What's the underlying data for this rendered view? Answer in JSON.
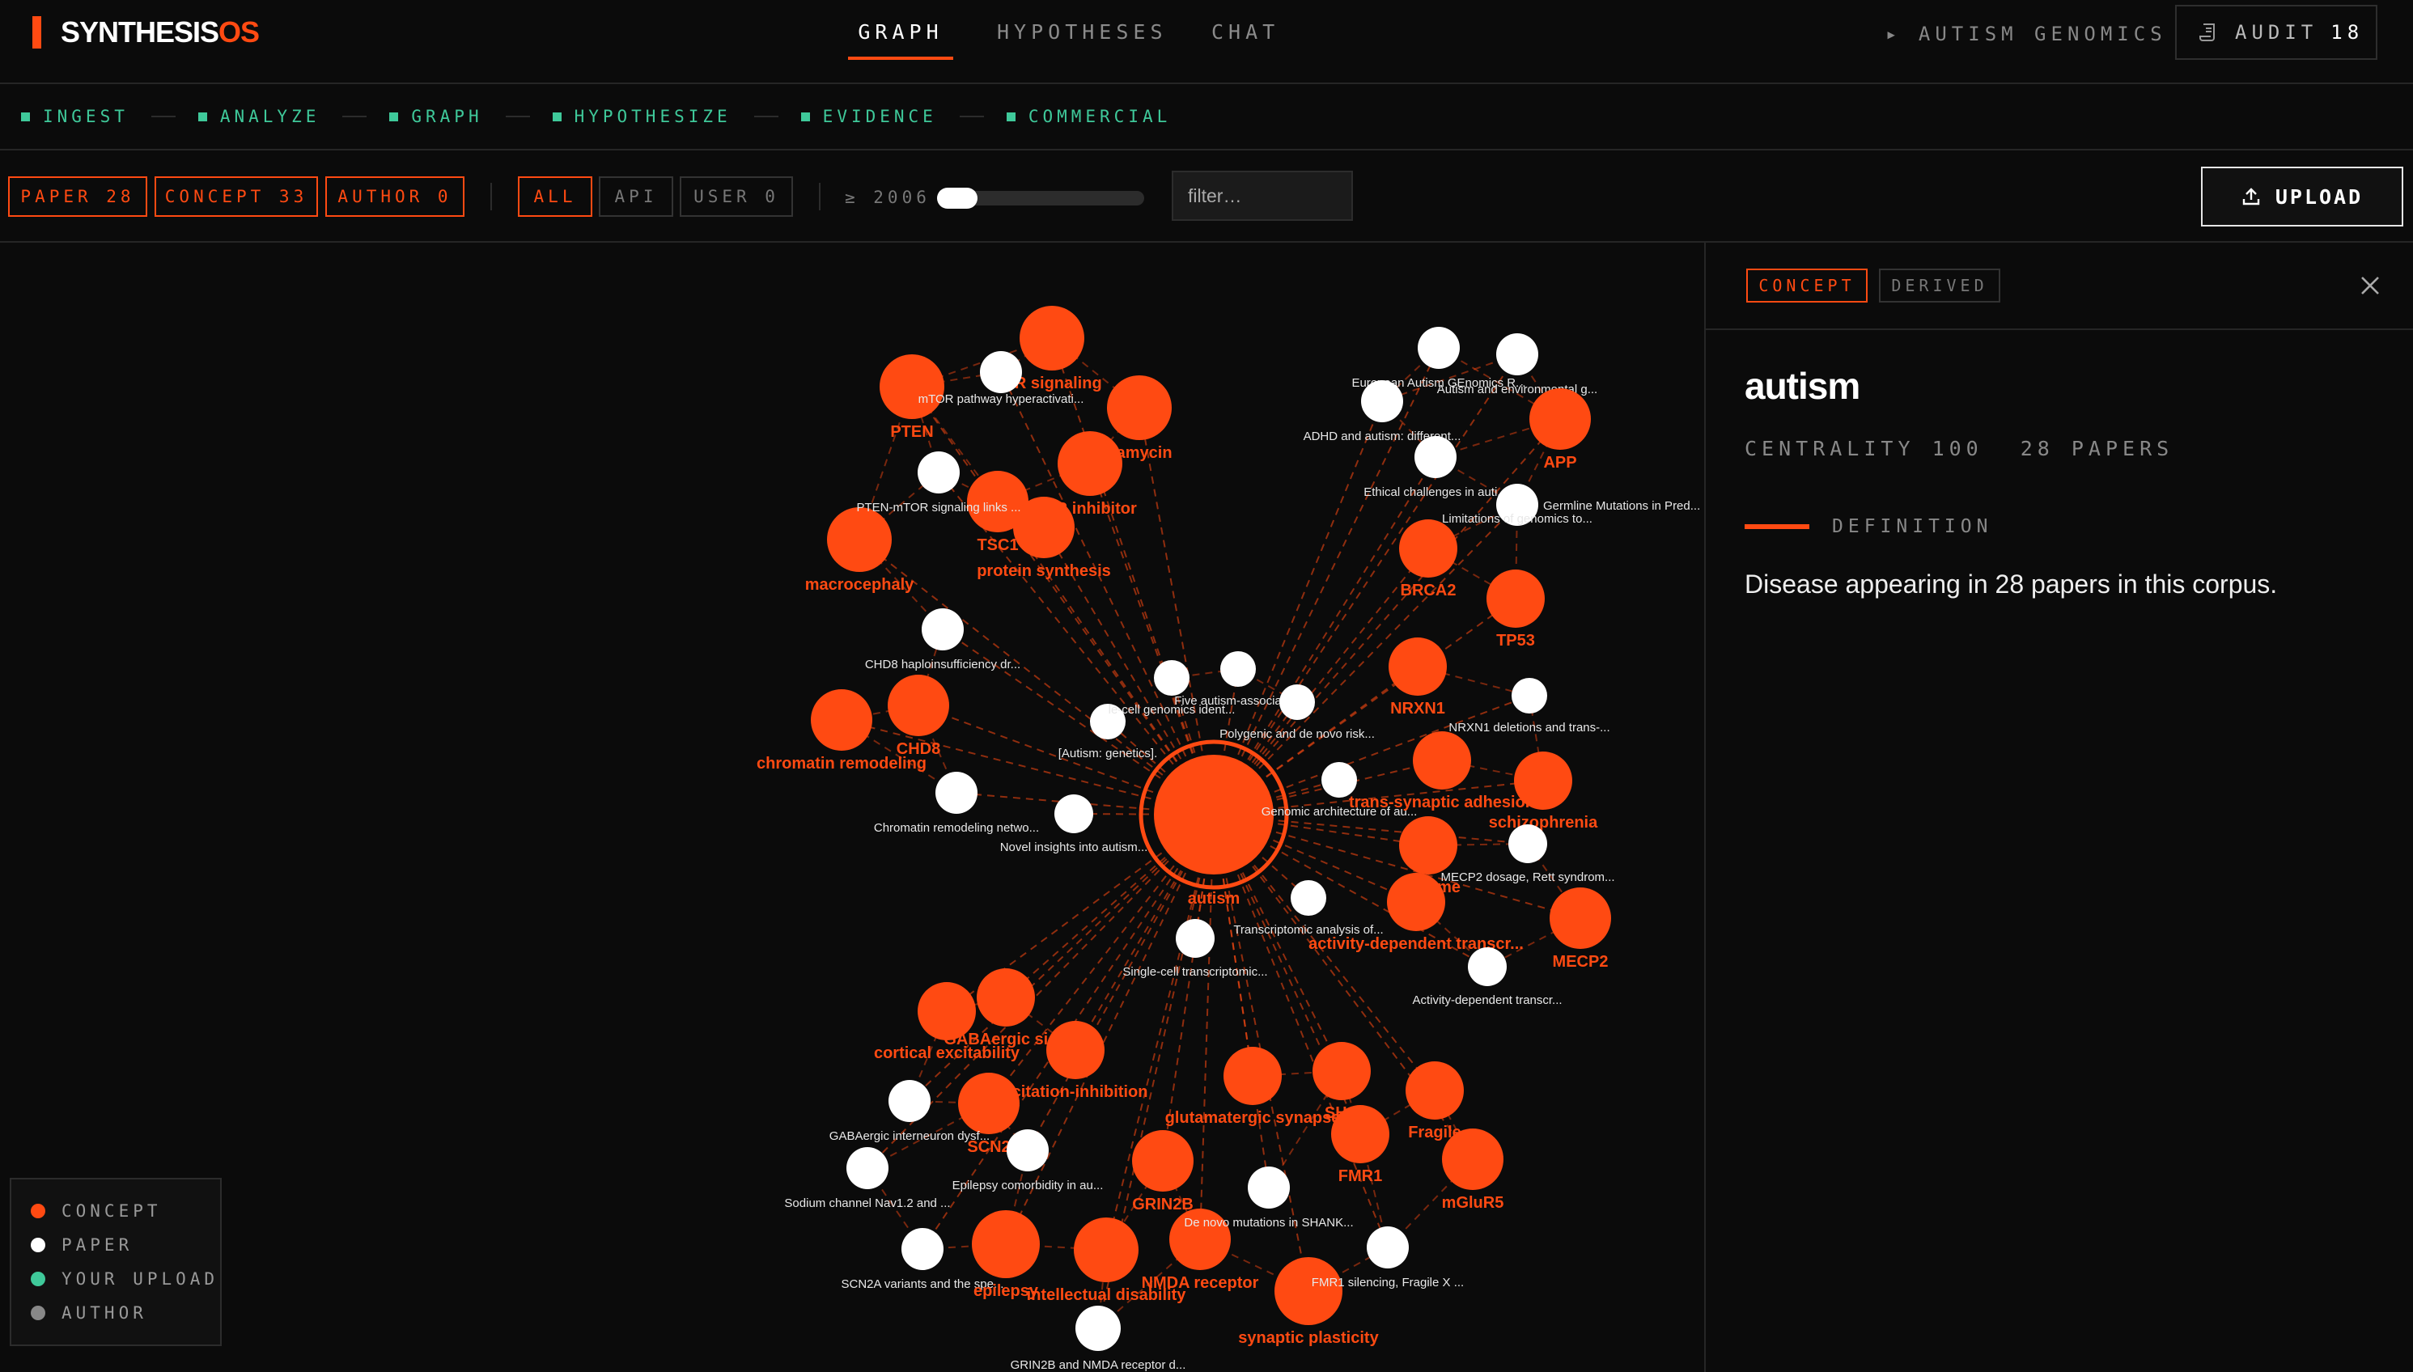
{
  "app": {
    "name_main": "SYNTHESIS",
    "name_suffix": "OS"
  },
  "nav": {
    "tabs": [
      {
        "label": "GRAPH",
        "active": true
      },
      {
        "label": "HYPOTHESES"
      },
      {
        "label": "CHAT"
      }
    ]
  },
  "project": {
    "label": "▸ AUTISM GENOMICS"
  },
  "audit": {
    "label": "AUDIT",
    "count": "18"
  },
  "pipeline": {
    "stages": [
      "INGEST",
      "ANALYZE",
      "GRAPH",
      "HYPOTHESIZE",
      "EVIDENCE",
      "COMMERCIAL"
    ]
  },
  "filters": {
    "paper": "PAPER 28",
    "concept": "CONCEPT 33",
    "author": "AUTHOR 0",
    "all": "ALL",
    "api": "API",
    "user": "USER 0",
    "since": "≥ 2006",
    "placeholder": "filter…"
  },
  "upload": {
    "label": "UPLOAD"
  },
  "legend": {
    "concept": "CONCEPT",
    "paper": "PAPER",
    "upload": "YOUR UPLOAD",
    "author": "AUTHOR"
  },
  "colors": {
    "accent": "#ff4a12",
    "paper": "#ffffff",
    "upload": "#3fc99a",
    "author": "#888888"
  },
  "graph": {
    "center": {
      "id": "autism",
      "label": "autism"
    },
    "nodes": [
      {
        "id": "pten",
        "type": "concept",
        "label": "PTEN"
      },
      {
        "id": "mtor",
        "type": "concept",
        "label": "OR signaling"
      },
      {
        "id": "rapamycin",
        "type": "concept",
        "label": "pamycin"
      },
      {
        "id": "mtorinh",
        "type": "concept",
        "label": "OR inhibitor"
      },
      {
        "id": "tsc1",
        "type": "concept",
        "label": "TSC1"
      },
      {
        "id": "protsyn",
        "type": "concept",
        "label": "protein synthesis"
      },
      {
        "id": "macro",
        "type": "concept",
        "label": "macrocephaly"
      },
      {
        "id": "chd8",
        "type": "concept",
        "label": "CHD8"
      },
      {
        "id": "chrom",
        "type": "concept",
        "label": "chromatin remodeling"
      },
      {
        "id": "p_mtorhyper",
        "type": "paper",
        "label": "mTOR pathway hyperactivati..."
      },
      {
        "id": "p_ptenmtor",
        "type": "paper",
        "label": "PTEN-mTOR signaling links ..."
      },
      {
        "id": "p_chd8",
        "type": "paper",
        "label": "CHD8 haploinsufficiency dr..."
      },
      {
        "id": "p_chrom",
        "type": "paper",
        "label": "Chromatin remodeling netwo..."
      },
      {
        "id": "p_novel",
        "type": "paper",
        "label": "Novel insights into autism..."
      },
      {
        "id": "p_autgen",
        "type": "paper",
        "label": "[Autism: genetics]."
      },
      {
        "id": "p_singlecell",
        "type": "paper",
        "label": "le-cell genomics ident..."
      },
      {
        "id": "p_five",
        "type": "paper",
        "label": "Five autism-associate..."
      },
      {
        "id": "p_poly",
        "type": "paper",
        "label": "Polygenic and de novo risk..."
      },
      {
        "id": "p_genarch",
        "type": "paper",
        "label": "Genomic architecture of au..."
      },
      {
        "id": "p_euro",
        "type": "paper",
        "label": "European Autism GEnomics R..."
      },
      {
        "id": "p_envir",
        "type": "paper",
        "label": "Autism and environmental g..."
      },
      {
        "id": "p_adhd",
        "type": "paper",
        "label": "ADHD and autism: different..."
      },
      {
        "id": "p_ethic",
        "type": "paper",
        "label": "Ethical challenges in auti..."
      },
      {
        "id": "p_germ",
        "type": "paper",
        "label": "Germline Mutations in Pred..."
      },
      {
        "id": "p_limit",
        "type": "paper",
        "label": "Limitations of genomics to..."
      },
      {
        "id": "app",
        "type": "concept",
        "label": "APP"
      },
      {
        "id": "brca2",
        "type": "concept",
        "label": "BRCA2"
      },
      {
        "id": "tp53",
        "type": "concept",
        "label": "TP53"
      },
      {
        "id": "nrxn1",
        "type": "concept",
        "label": "NRXN1"
      },
      {
        "id": "p_nrxn1",
        "type": "paper",
        "label": "NRXN1 deletions and trans-..."
      },
      {
        "id": "transsyn",
        "type": "concept",
        "label": "trans-synaptic adhesion"
      },
      {
        "id": "schizo",
        "type": "concept",
        "label": "schizophrenia"
      },
      {
        "id": "rett",
        "type": "concept",
        "label": "Re     rome"
      },
      {
        "id": "p_mecp2",
        "type": "paper",
        "label": "MECP2 dosage, Rett syndrom..."
      },
      {
        "id": "actdep",
        "type": "concept",
        "label": "activity-dependent transcr..."
      },
      {
        "id": "mecp2",
        "type": "concept",
        "label": "MECP2"
      },
      {
        "id": "p_transc",
        "type": "paper",
        "label": "Transcriptomic analysis of..."
      },
      {
        "id": "p_sctrans",
        "type": "paper",
        "label": "Single-cell transcriptomic..."
      },
      {
        "id": "p_actdep",
        "type": "paper",
        "label": "Activity-dependent transcr..."
      },
      {
        "id": "gaba",
        "type": "concept",
        "label": "GABAergic sign"
      },
      {
        "id": "cortexc",
        "type": "concept",
        "label": "cortical excitability"
      },
      {
        "id": "excinh",
        "type": "concept",
        "label": "xcitation-inhibition"
      },
      {
        "id": "scn2",
        "type": "concept",
        "label": "SCN2"
      },
      {
        "id": "p_gaba",
        "type": "paper",
        "label": "GABAergic interneuron dysf..."
      },
      {
        "id": "p_scn",
        "type": "paper",
        "label": "Sodium channel Nav1.2 and ..."
      },
      {
        "id": "p_epi",
        "type": "paper",
        "label": "Epilepsy comorbidity in au..."
      },
      {
        "id": "p_scn2a",
        "type": "paper",
        "label": "SCN2A variants and the spe..."
      },
      {
        "id": "epilepsy",
        "type": "concept",
        "label": "epilepsy"
      },
      {
        "id": "intdis",
        "type": "concept",
        "label": "intellectual disability"
      },
      {
        "id": "p_grin",
        "type": "paper",
        "label": "GRIN2B and NMDA receptor d..."
      },
      {
        "id": "grin2b",
        "type": "concept",
        "label": "GRIN2B"
      },
      {
        "id": "nmda",
        "type": "concept",
        "label": "NMDA receptor"
      },
      {
        "id": "glut",
        "type": "concept",
        "label": "glutamatergic synapse"
      },
      {
        "id": "shank",
        "type": "concept",
        "label": "SHA"
      },
      {
        "id": "fmr1",
        "type": "concept",
        "label": "FMR1"
      },
      {
        "id": "fragile",
        "type": "concept",
        "label": "Fragile"
      },
      {
        "id": "mglur5",
        "type": "concept",
        "label": "mGluR5"
      },
      {
        "id": "synplast",
        "type": "concept",
        "label": "synaptic plasticity"
      },
      {
        "id": "p_denovo",
        "type": "paper",
        "label": "De novo mutations in SHANK..."
      },
      {
        "id": "p_fmr1",
        "type": "paper",
        "label": "FMR1 silencing, Fragile X ..."
      }
    ]
  },
  "panel": {
    "tags": {
      "concept": "CONCEPT",
      "derived": "DERIVED"
    },
    "title": "autism",
    "centrality": "CENTRALITY 100",
    "papers": "28 PAPERS",
    "definition_label": "DEFINITION",
    "definition": "Disease appearing in 28 papers in this corpus."
  }
}
